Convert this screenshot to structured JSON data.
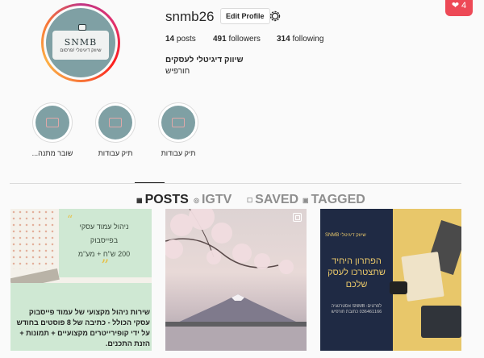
{
  "notification": {
    "count": "4",
    "icon": "heart-icon",
    "color": "#ed4956"
  },
  "profile": {
    "username": "snmb26",
    "edit_label": "Edit Profile",
    "avatar": {
      "brand": "SNMB",
      "tagline": "שיווק דיגיטלי /פרסום"
    },
    "stats": {
      "posts_count": "14",
      "posts_label": "posts",
      "followers_count": "491",
      "followers_label": "followers",
      "following_count": "314",
      "following_label": "following"
    },
    "bio_name": "שיווק דיגיטלי לעסקים",
    "bio_line": "חורפיש"
  },
  "highlights": [
    {
      "label": "שובר מתנה..."
    },
    {
      "label": "תיק עבודות"
    },
    {
      "label": "תיק עבודות"
    }
  ],
  "tabs": [
    {
      "label": "POSTS",
      "icon": "grid-icon",
      "active": true
    },
    {
      "label": "IGTV",
      "icon": "igtv-icon",
      "active": false
    },
    {
      "label": "SAVED",
      "icon": "bookmark-icon",
      "active": false
    },
    {
      "label": "TAGGED",
      "icon": "tag-icon",
      "active": false
    }
  ],
  "posts": [
    {
      "headline_line1": "ניהול עמוד עסקי",
      "headline_line2": "בפייסבוק",
      "headline_line3": "200 ש\"ח + מע\"מ",
      "caption": "שירות ניהול מקצועי של עמוד פייסבוק עסקי הכולל - כתיבה של 8 פוסטים בחודש על ידי קופירייטרים מקצועיים + תמונות + הזנת התכנים."
    },
    {
      "type": "photo",
      "multi": true
    },
    {
      "brand": "SNMB שיווק דיגיטלי",
      "headline": "הפתרון היחיד שתצטרכו לעסק שלכם",
      "small": "לפרטים: SNMB אסטרטגיה 036461166 כתובת חורפיש"
    }
  ]
}
